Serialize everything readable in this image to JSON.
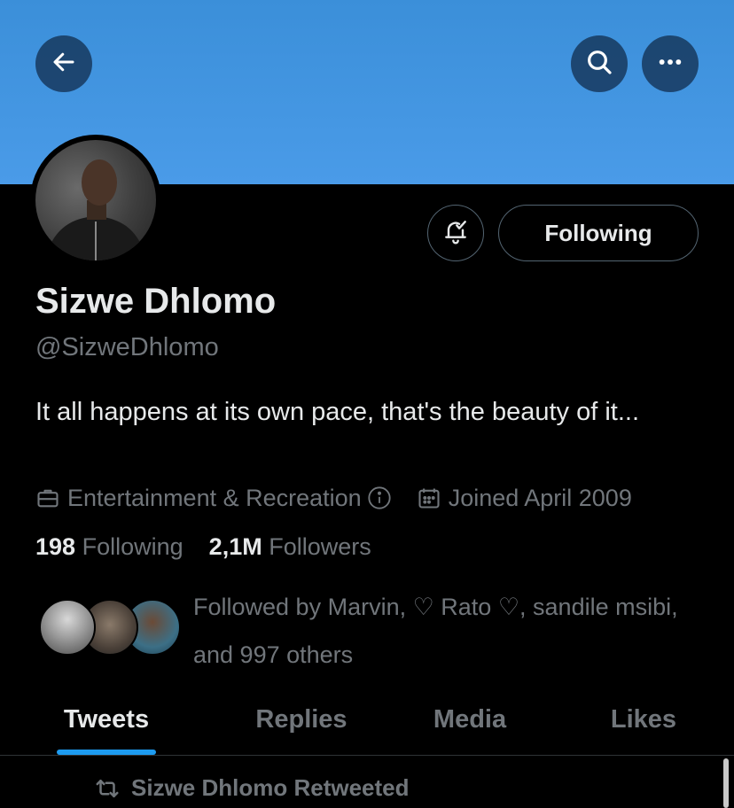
{
  "header": {
    "back_icon": "arrow-left-icon",
    "search_icon": "search-icon",
    "more_icon": "more-horizontal-icon",
    "banner_color": "#4a9be8"
  },
  "profile": {
    "name": "Sizwe Dhlomo",
    "handle": "@SizweDhlomo",
    "bio": "It all happens at its own pace, that's the beauty of it...",
    "category": "Entertainment & Recreation",
    "joined": "Joined April 2009",
    "following_count": "198",
    "following_label": "Following",
    "followers_count": "2,1M",
    "followers_label": "Followers",
    "followed_by": "Followed by Marvin, ♡ Rato ♡, sandile msibi, and 997 others"
  },
  "actions": {
    "notification_icon": "bell-check-icon",
    "following_button": "Following"
  },
  "tabs": [
    {
      "label": "Tweets",
      "active": true
    },
    {
      "label": "Replies",
      "active": false
    },
    {
      "label": "Media",
      "active": false
    },
    {
      "label": "Likes",
      "active": false
    }
  ],
  "timeline": {
    "retweet_label": "Sizwe Dhlomo Retweeted",
    "retweet_icon": "retweet-icon"
  },
  "colors": {
    "accent": "#1d9bf0",
    "background": "#000000",
    "secondary_text": "#71767b"
  }
}
